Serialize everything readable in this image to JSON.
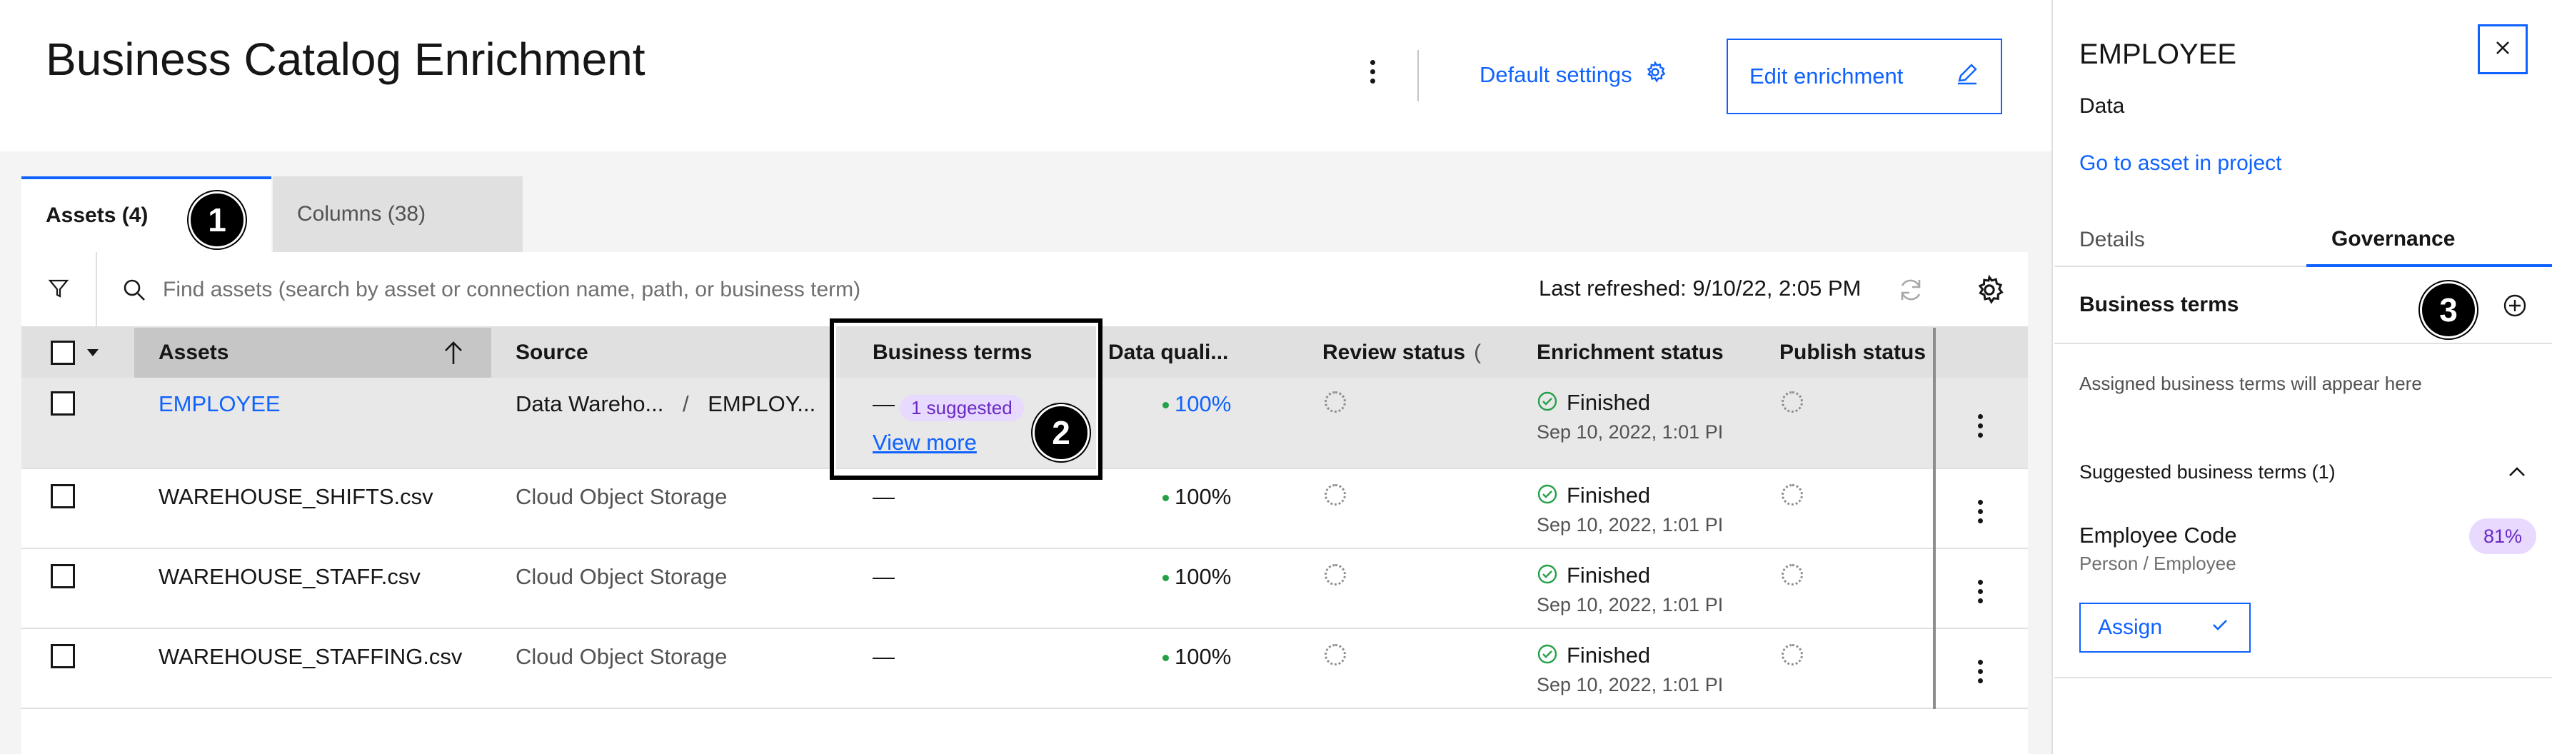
{
  "header": {
    "title": "Business Catalog Enrichment",
    "default_settings_label": "Default settings",
    "edit_enrichment_label": "Edit enrichment"
  },
  "tabs": [
    {
      "label": "Assets (4)",
      "selected": true
    },
    {
      "label": "Columns (38)",
      "selected": false
    }
  ],
  "callouts": [
    "1",
    "2",
    "3"
  ],
  "toolbar": {
    "search_placeholder": "Find assets (search by asset or connection name, path, or business term)",
    "last_refreshed": "Last refreshed: 9/10/22, 2:05 PM"
  },
  "table": {
    "columns": {
      "assets": "Assets",
      "source": "Source",
      "business_terms": "Business terms",
      "data_quality": "Data quali...",
      "review_status": "Review status",
      "review_status_suffix": "(",
      "enrichment_status": "Enrichment status",
      "publish_status": "Publish status"
    },
    "rows": [
      {
        "name": "EMPLOYEE",
        "source": "Data Wareho...",
        "source_sep": "/",
        "source_path": "EMPLOY...",
        "business_terms": "—",
        "suggested_tag": "1 suggested",
        "view_more": "View more",
        "data_quality": "100%",
        "enrichment_status": "Finished",
        "enrichment_date": "Sep 10, 2022, 1:01 PI"
      },
      {
        "name": "WAREHOUSE_SHIFTS.csv",
        "source": "Cloud Object Storage",
        "business_terms": "—",
        "data_quality": "100%",
        "enrichment_status": "Finished",
        "enrichment_date": "Sep 10, 2022, 1:01 PI"
      },
      {
        "name": "WAREHOUSE_STAFF.csv",
        "source": "Cloud Object Storage",
        "business_terms": "—",
        "data_quality": "100%",
        "enrichment_status": "Finished",
        "enrichment_date": "Sep 10, 2022, 1:01 PI"
      },
      {
        "name": "WAREHOUSE_STAFFING.csv",
        "source": "Cloud Object Storage",
        "business_terms": "—",
        "data_quality": "100%",
        "enrichment_status": "Finished",
        "enrichment_date": "Sep 10, 2022, 1:01 PI"
      }
    ]
  },
  "side_panel": {
    "title": "EMPLOYEE",
    "subtitle": "Data",
    "goto_link": "Go to asset in project",
    "tabs": [
      {
        "label": "Details",
        "selected": false
      },
      {
        "label": "Governance",
        "selected": true
      }
    ],
    "business_terms_heading": "Business terms",
    "empty_message": "Assigned business terms will appear here",
    "suggested_heading": "Suggested business terms (1)",
    "suggested_terms": [
      {
        "name": "Employee Code",
        "path": "Person / Employee",
        "score": "81%"
      }
    ],
    "assign_label": "Assign"
  },
  "colors": {
    "accent": "#0f62fe",
    "success": "#24a148",
    "tag_bg": "#e8daff",
    "tag_text": "#6929c4"
  }
}
